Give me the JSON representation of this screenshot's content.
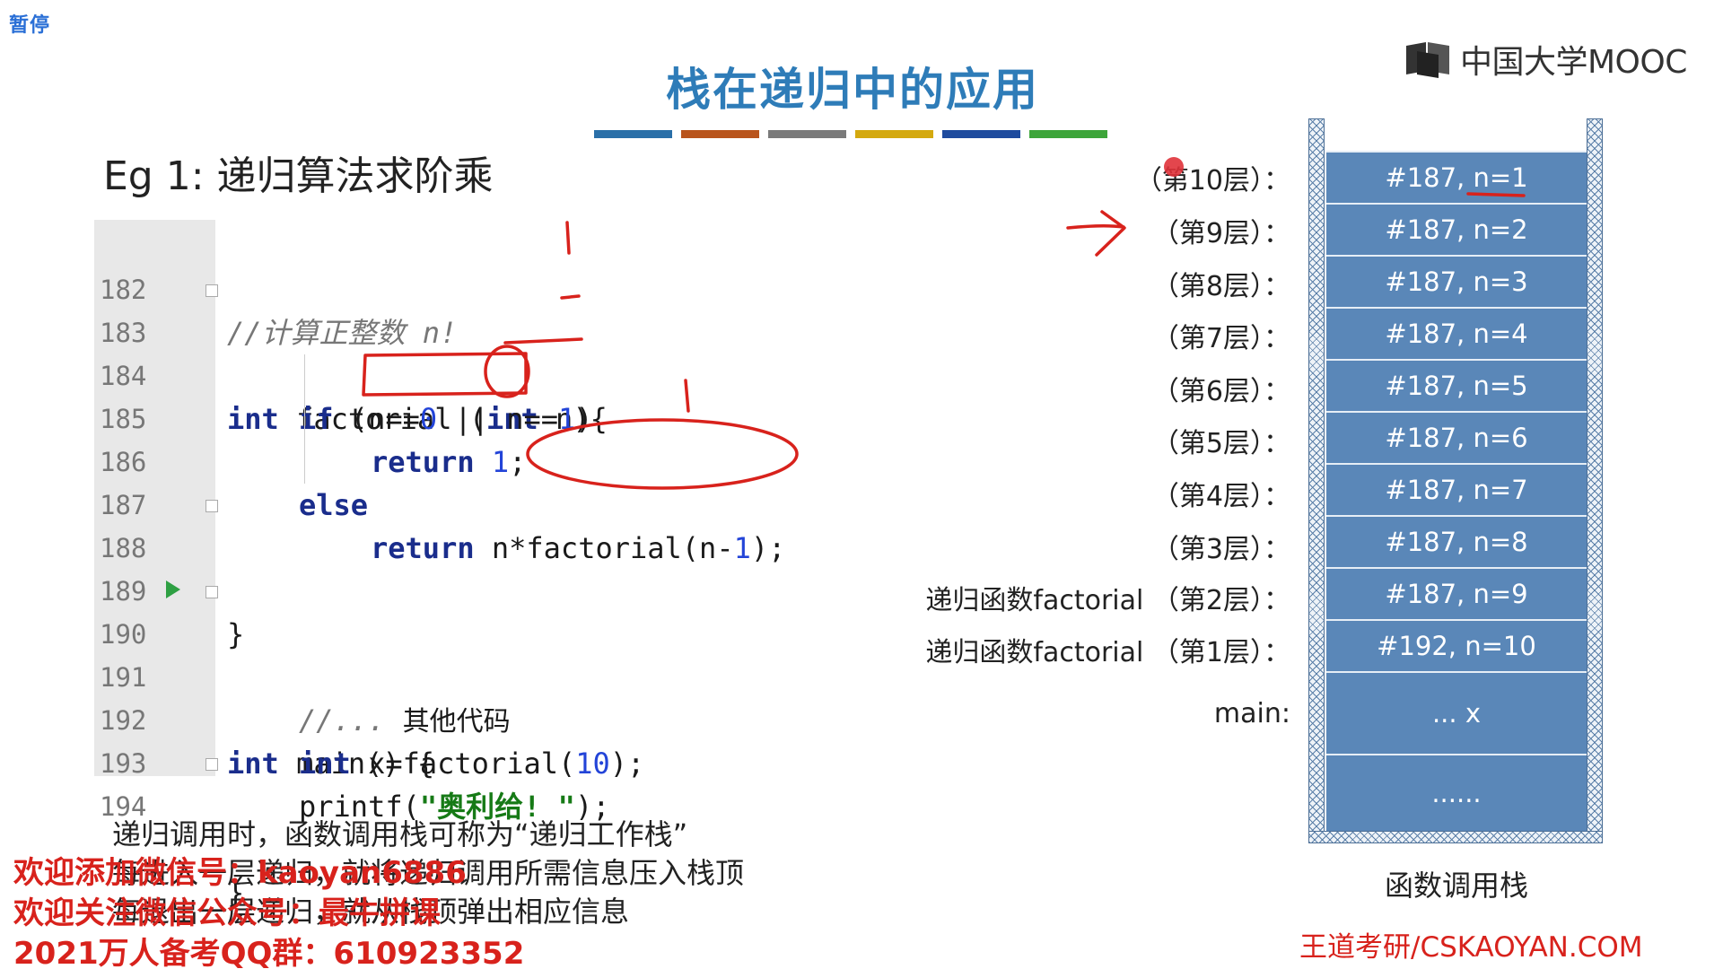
{
  "player": {
    "status": "暂停"
  },
  "logo": {
    "text": "中国大学MOOC"
  },
  "slide": {
    "title": "栈在递归中的应用",
    "accent_colors": [
      "#2a6fa8",
      "#b9541c",
      "#7a7a7a",
      "#d4a90f",
      "#1e4b9e",
      "#3da53a"
    ],
    "example_title": "Eg 1:  递归算法求阶乘"
  },
  "code": {
    "lines": [
      {
        "number": "182",
        "comment": "//计算正整数 n!"
      },
      {
        "number": "183",
        "kw1": "int",
        "text1": " factorial (",
        "kw2": "int",
        "text2": " n){"
      },
      {
        "number": "184",
        "kw1": "if",
        "text1": " (n==",
        "num1": "0",
        "text2": " || n==",
        "num2": "1",
        "text3": ")"
      },
      {
        "number": "185",
        "kw1": "return",
        "text1": " ",
        "num1": "1",
        "text2": ";"
      },
      {
        "number": "186",
        "kw1": "else"
      },
      {
        "number": "187",
        "kw1": "return",
        "text1": " n*factorial(n-",
        "num1": "1",
        "text2": ");"
      },
      {
        "number": "188",
        "text1": "}"
      },
      {
        "number": "189"
      },
      {
        "number": "190",
        "kw1": "int",
        "text1": " main() {"
      },
      {
        "number": "191",
        "comment": "//... ",
        "text1": "其他代码"
      },
      {
        "number": "192",
        "kw1": "int",
        "text1": " x=factorial(",
        "num1": "10",
        "text2": ");"
      },
      {
        "number": "193",
        "text1": "printf(",
        "str1": "\"奥利给! \"",
        "text2": ");"
      },
      {
        "number": "194",
        "text1": "}"
      }
    ]
  },
  "explanation": [
    "递归调用时，函数调用栈可称为“递归工作栈”",
    "每进入一层递归，就将递归调用所需信息压入栈顶",
    "每退出一层递归，就从栈顶弹出相应信息"
  ],
  "overlay": [
    "欢迎添加微信号：kaoyan6886",
    "欢迎关注微信公众号：最牛拼课",
    "2021万人备考QQ群：610923352"
  ],
  "stack": {
    "labels": [
      "（第10层）：",
      "（第9层）：",
      "（第8层）：",
      "（第7层）：",
      "（第6层）：",
      "（第5层）：",
      "（第4层）：",
      "（第3层）：",
      "递归函数factorial （第2层）：",
      "递归函数factorial （第1层）：",
      "main:"
    ],
    "cells": [
      "#187, n=1",
      "#187, n=2",
      "#187, n=3",
      "#187, n=4",
      "#187, n=5",
      "#187, n=6",
      "#187, n=7",
      "#187, n=8",
      "#187, n=9",
      "#192, n=10",
      "... x",
      "......"
    ],
    "caption": "函数调用栈"
  },
  "brand": {
    "text": "王道考研/CSKAOYAN.COM"
  },
  "colors": {
    "title": "#2e7cb8",
    "stack_cell": "#5a87b8",
    "annotation": "#d8221c",
    "keyword": "#1a2d8c",
    "number": "#2344d8",
    "string": "#167a16"
  }
}
